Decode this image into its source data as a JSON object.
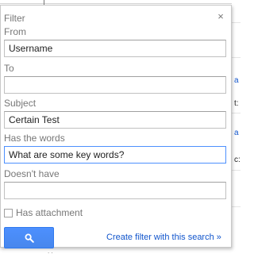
{
  "filter_dialog": {
    "title": "Filter",
    "close_symbol": "×",
    "from": {
      "label": "From",
      "value": "Username"
    },
    "to": {
      "label": "To",
      "value": ""
    },
    "subject": {
      "label": "Subject",
      "value": "Certain Test"
    },
    "has_words": {
      "label": "Has the words",
      "value": "What are some key words?"
    },
    "doesnt_have": {
      "label": "Doesn't have",
      "value": ""
    },
    "has_attachment": {
      "label": "Has attachment",
      "checked": false
    },
    "search_button": {
      "icon": "search-icon"
    },
    "create_filter_link": "Create filter with this search »"
  },
  "background_fragments": [
    "a",
    "t:",
    "a",
    "c:"
  ],
  "colors": {
    "search_button": "#4d90fe",
    "link": "#1155cc",
    "label": "#777777",
    "focus_border": "#4d90fe"
  }
}
